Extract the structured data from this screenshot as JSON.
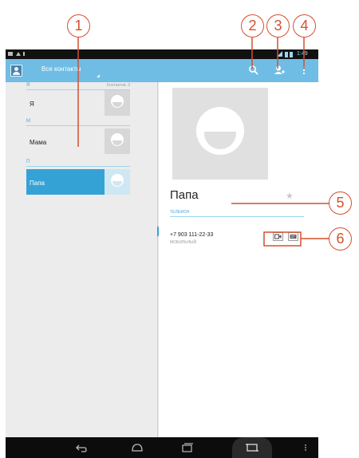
{
  "status_bar": {
    "time": "1:49"
  },
  "action_bar": {
    "title": "Все контакты"
  },
  "contacts_list": {
    "count_label": "Контактов: 3",
    "sections": [
      {
        "letter": "Я",
        "header": "Я"
      },
      {
        "letter": "М",
        "header": "М"
      },
      {
        "letter": "П",
        "header": "П"
      }
    ],
    "contacts": [
      {
        "name": "Я",
        "selected": false
      },
      {
        "name": "Мама",
        "selected": false
      },
      {
        "name": "Папа",
        "selected": true
      }
    ]
  },
  "detail": {
    "name": "Папа",
    "section_phone": "ТЕЛЕФОН",
    "phone_number": "+7 903 111-22-33",
    "phone_type": "МОБИЛЬНЫЙ"
  },
  "callouts": [
    "1",
    "2",
    "3",
    "4",
    "5",
    "6"
  ],
  "colors": {
    "accent": "#35a2d6",
    "action_bar": "#6fbde4",
    "callout": "#d4502f"
  }
}
